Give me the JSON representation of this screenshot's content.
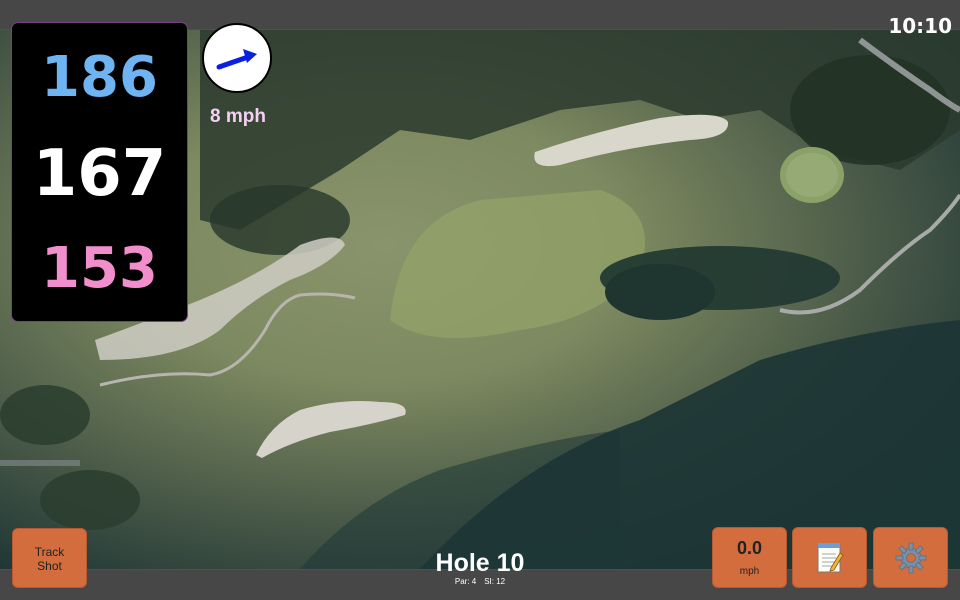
{
  "status": {
    "clock": "10:10"
  },
  "distances": {
    "back": "186",
    "middle": "167",
    "front": "153"
  },
  "wind": {
    "speed_text": "8 mph",
    "icon": "wind-direction-arrow-icon",
    "arrow_color": "#0a1fe0"
  },
  "hole": {
    "title": "Hole 10",
    "par_text": "Par: 4",
    "si_text": "SI: 12"
  },
  "buttons": {
    "track_shot_line1": "Track",
    "track_shot_line2": "Shot",
    "speed_value": "0.0",
    "speed_unit": "mph",
    "notes_icon": "notepad-icon",
    "settings_icon": "gear-icon"
  },
  "colors": {
    "back_distance": "#6fb4f2",
    "middle_distance": "#ffffff",
    "front_distance": "#f08fcc",
    "button_orange": "#d46d3e",
    "panel_border": "#7a3f86"
  }
}
